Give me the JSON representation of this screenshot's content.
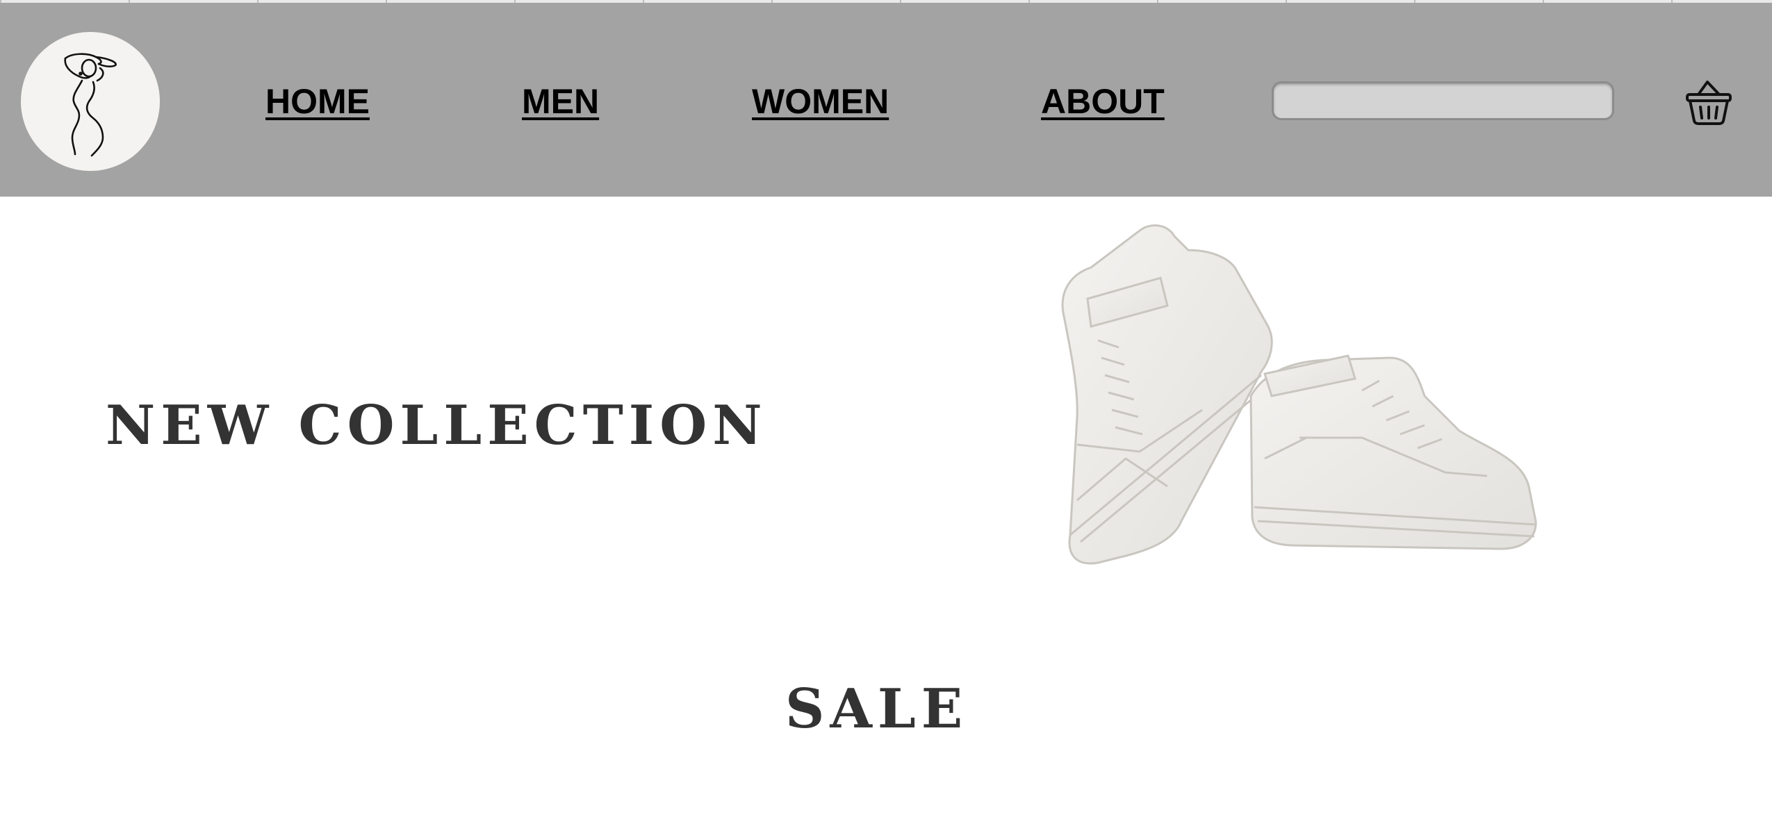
{
  "header": {
    "logo_icon": "line-art-figure-logo-icon",
    "nav": {
      "home_label": "HOME",
      "men_label": "MEN",
      "women_label": "WOMEN",
      "about_label": "ABOUT"
    },
    "search": {
      "value": "",
      "placeholder": ""
    },
    "cart_icon": "basket-icon"
  },
  "hero": {
    "title": "NEW COLLECTION",
    "image_icon": "white-sneakers-image"
  },
  "sale": {
    "title": "SALE"
  },
  "colors": {
    "header_bg": "#a3a3a3",
    "logo_bg": "#f4f3f1",
    "search_bg": "#d3d3d3",
    "heading_text": "#333333",
    "nav_text": "#000000"
  }
}
